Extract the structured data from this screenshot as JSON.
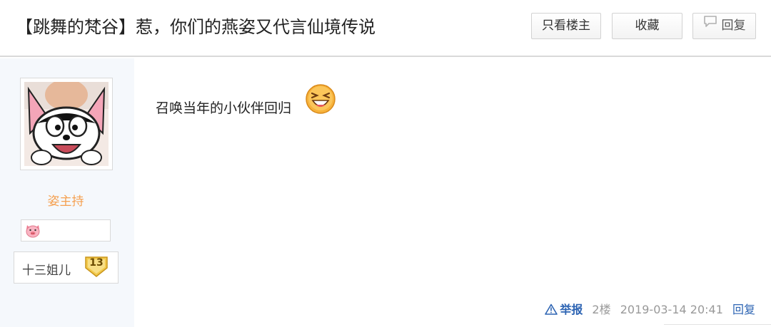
{
  "header": {
    "title": "【跳舞的梵谷】惹，你们的燕姿又代言仙境传说",
    "only_author_label": "只看楼主",
    "favorite_label": "收藏",
    "reply_label": "回复",
    "reply_icon": "speech-bubble-icon"
  },
  "author": {
    "avatar": "cartoon-dog-avatar",
    "name": "姿主持",
    "badge_icon": "pig-icon",
    "level_name": "十三姐儿",
    "level": "13"
  },
  "post": {
    "text": "召唤当年的小伙伴回归",
    "emoji": "laughing-face-icon"
  },
  "footer": {
    "report_label": "举报",
    "report_icon": "warning-triangle-icon",
    "floor": "2楼",
    "time": "2019-03-14 20:41",
    "reply_label": "回复"
  },
  "colors": {
    "username": "#f5a050",
    "link": "#2d64b3",
    "sidebar_bg": "#f5f8fc",
    "badge_gold": "#f2c94c"
  }
}
